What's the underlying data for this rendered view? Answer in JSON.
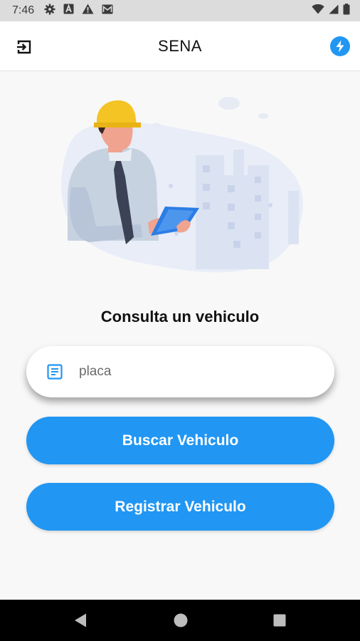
{
  "status_bar": {
    "time": "7:46",
    "left_icons": [
      "settings-icon",
      "a-badge-icon",
      "warning-icon",
      "gmail-icon"
    ],
    "right_icons": [
      "wifi-icon",
      "signal-icon",
      "battery-icon"
    ]
  },
  "app_bar": {
    "title": "SENA",
    "left_icon": "logout-icon",
    "right_icon": "bolt-icon",
    "accent": "#2196f3"
  },
  "main": {
    "heading": "Consulta un vehiculo",
    "search": {
      "placeholder": "placa",
      "value": "",
      "icon": "document-icon"
    },
    "buttons": {
      "search_label": "Buscar Vehiculo",
      "register_label": "Registrar Vehiculo"
    }
  },
  "nav_bar": {
    "icons": [
      "back-icon",
      "home-icon",
      "recents-icon"
    ]
  },
  "colors": {
    "primary": "#2196f3",
    "background": "#f8f8f8",
    "status_bar": "#dcdcdc",
    "nav_bar": "#000000"
  }
}
